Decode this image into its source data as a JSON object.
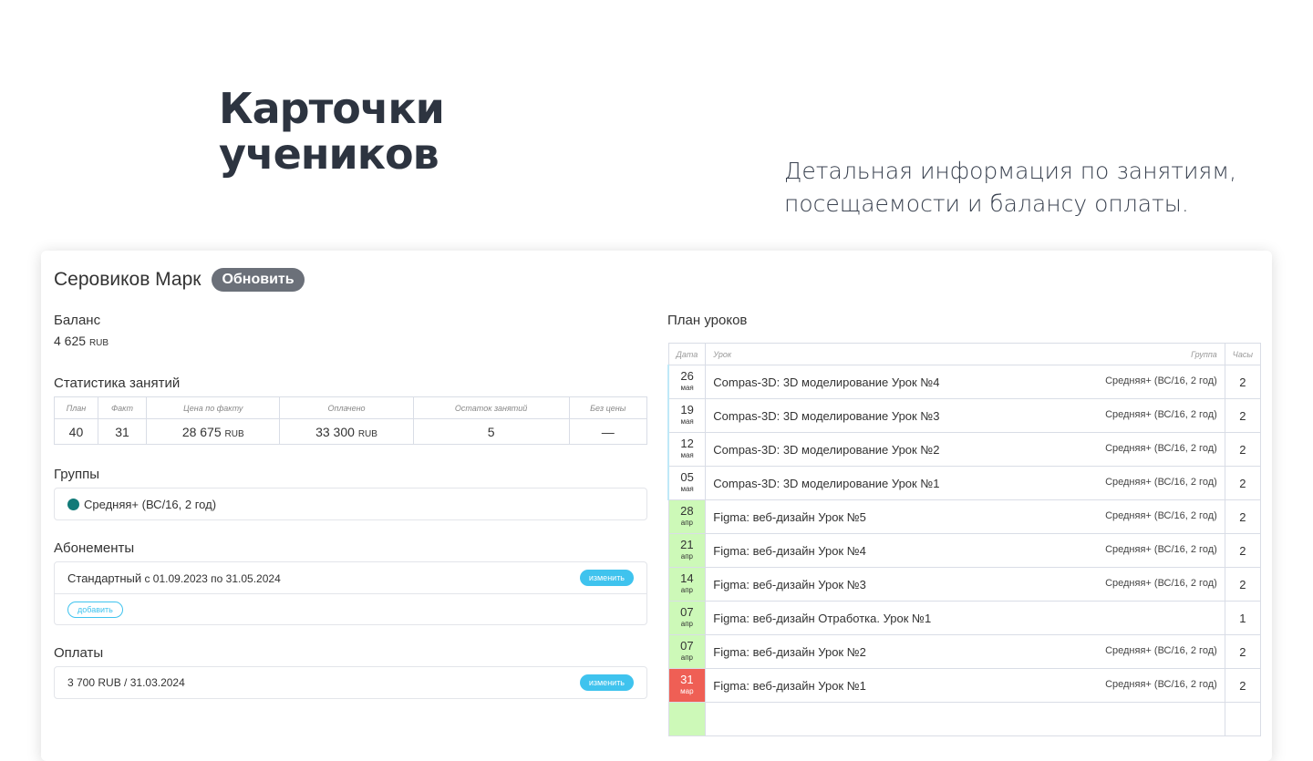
{
  "hero": {
    "title_line1": "Карточки",
    "title_line2": "учеников",
    "subtitle_line1": "Детальная информация по занятиям,",
    "subtitle_line2": "посещаемости и балансу оплаты."
  },
  "student": {
    "name": "Серовиков Марк",
    "refresh_label": "Обновить"
  },
  "balance": {
    "label": "Баланс",
    "value": "4 625",
    "currency": "RUB"
  },
  "stats": {
    "label": "Статистика занятий",
    "headers": [
      "План",
      "Факт",
      "Цена по факту",
      "Оплачено",
      "Остаток занятий",
      "Без цены"
    ],
    "values": [
      "40",
      "31",
      "28 675",
      "33 300",
      "5",
      "—"
    ],
    "currency": "RUB"
  },
  "groups": {
    "label": "Группы",
    "items": [
      {
        "name": "Средняя+ (ВС/16, 2 год)",
        "color": "#117a78"
      }
    ]
  },
  "subscriptions": {
    "label": "Абонементы",
    "items": [
      {
        "name": "Стандартный",
        "period": "с 01.09.2023 по 31.05.2024",
        "edit_label": "изменить"
      }
    ],
    "add_label": "добавить"
  },
  "payments": {
    "label": "Оплаты",
    "items": [
      {
        "amount": "3 700 RUB",
        "date": "/ 31.03.2024",
        "edit_label": "изменить"
      }
    ]
  },
  "plan": {
    "label": "План уроков",
    "headers": {
      "date": "Дата",
      "lesson": "Урок",
      "group": "Группа",
      "hours": "Часы"
    },
    "rows": [
      {
        "day": "26",
        "month": "мая",
        "status": "may",
        "lesson": "Compas-3D: 3D моделирование Урок №4",
        "group": "Средняя+ (ВС/16, 2 год)",
        "hours": "2"
      },
      {
        "day": "19",
        "month": "мая",
        "status": "may",
        "lesson": "Compas-3D: 3D моделирование Урок №3",
        "group": "Средняя+ (ВС/16, 2 год)",
        "hours": "2"
      },
      {
        "day": "12",
        "month": "мая",
        "status": "may",
        "lesson": "Compas-3D: 3D моделирование Урок №2",
        "group": "Средняя+ (ВС/16, 2 год)",
        "hours": "2"
      },
      {
        "day": "05",
        "month": "мая",
        "status": "may",
        "lesson": "Compas-3D: 3D моделирование Урок №1",
        "group": "Средняя+ (ВС/16, 2 год)",
        "hours": "2"
      },
      {
        "day": "28",
        "month": "апр",
        "status": "apr",
        "lesson": "Figma: веб-дизайн Урок №5",
        "group": "Средняя+ (ВС/16, 2 год)",
        "hours": "2"
      },
      {
        "day": "21",
        "month": "апр",
        "status": "apr",
        "lesson": "Figma: веб-дизайн Урок №4",
        "group": "Средняя+ (ВС/16, 2 год)",
        "hours": "2"
      },
      {
        "day": "14",
        "month": "апр",
        "status": "apr",
        "lesson": "Figma: веб-дизайн Урок №3",
        "group": "Средняя+ (ВС/16, 2 год)",
        "hours": "2"
      },
      {
        "day": "07",
        "month": "апр",
        "status": "apr",
        "lesson": "Figma: веб-дизайн Отработка. Урок №1",
        "group": "",
        "hours": "1"
      },
      {
        "day": "07",
        "month": "апр",
        "status": "apr",
        "lesson": "Figma: веб-дизайн Урок №2",
        "group": "Средняя+ (ВС/16, 2 год)",
        "hours": "2"
      },
      {
        "day": "31",
        "month": "мар",
        "status": "mar",
        "lesson": "Figma: веб-дизайн Урок №1",
        "group": "Средняя+ (ВС/16, 2 год)",
        "hours": "2"
      }
    ]
  }
}
